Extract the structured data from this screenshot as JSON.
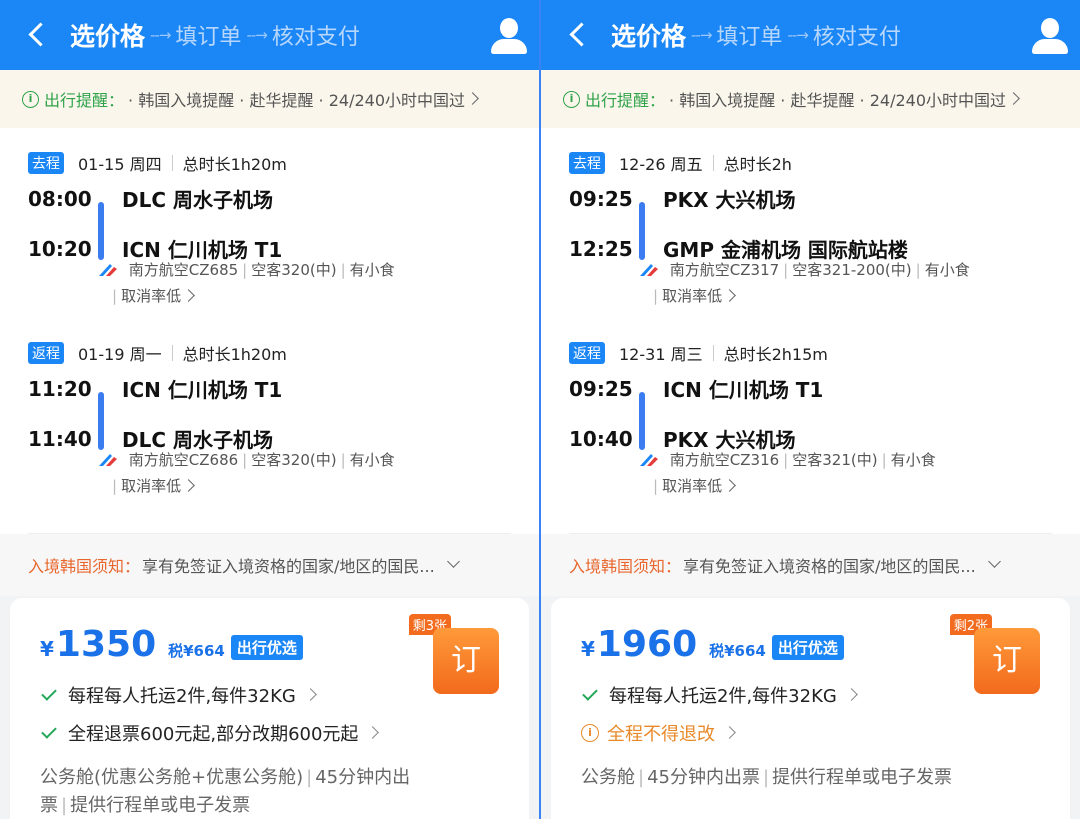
{
  "header": {
    "step_current": "选价格",
    "arrow": "--→",
    "step_2": "填订单",
    "step_3": "核对支付"
  },
  "reminder": {
    "title": "出行提醒",
    "colon": "：",
    "text": "· 韩国入境提醒 · 赴华提醒 · 24/240小时中国过"
  },
  "notice": {
    "title": "入境韩国须知",
    "colon": "：",
    "text": "享有免签证入境资格的国家/地区的国民..."
  },
  "left": {
    "outbound": {
      "tag": "去程",
      "date": "01-15 周四",
      "duration": "总时长1h20m",
      "dep_time": "08:00",
      "dep_airport": "DLC 周水子机场",
      "arr_time": "10:20",
      "arr_airport": "ICN 仁川机场 T1",
      "airline": "南方航空CZ685",
      "aircraft": "空客320(中)",
      "meal": "有小食",
      "cancel": "取消率低"
    },
    "return": {
      "tag": "返程",
      "date": "01-19 周一",
      "duration": "总时长1h20m",
      "dep_time": "11:20",
      "dep_airport": "ICN 仁川机场 T1",
      "arr_time": "11:40",
      "arr_airport": "DLC 周水子机场",
      "airline": "南方航空CZ686",
      "aircraft": "空客320(中)",
      "meal": "有小食",
      "cancel": "取消率低"
    },
    "card": {
      "currency": "¥",
      "price": "1350",
      "tax": "税¥664",
      "badge": "出行优选",
      "remain": "剩3张",
      "book": "订",
      "feature_1": "每程每人托运2件,每件32KG",
      "feature_2": "全程退票600元起,部分改期600元起",
      "cabin_1": "公务舱(优惠公务舱+优惠公务舱)",
      "cabin_2": "45分钟内出",
      "cabin_3": "票",
      "cabin_4": "提供行程单或电子发票"
    }
  },
  "right": {
    "outbound": {
      "tag": "去程",
      "date": "12-26 周五",
      "duration": "总时长2h",
      "dep_time": "09:25",
      "dep_airport": "PKX 大兴机场",
      "arr_time": "12:25",
      "arr_airport": "GMP 金浦机场 国际航站楼",
      "airline": "南方航空CZ317",
      "aircraft": "空客321-200(中)",
      "meal": "有小食",
      "cancel": "取消率低"
    },
    "return": {
      "tag": "返程",
      "date": "12-31 周三",
      "duration": "总时长2h15m",
      "dep_time": "09:25",
      "dep_airport": "ICN 仁川机场 T1",
      "arr_time": "10:40",
      "arr_airport": "PKX 大兴机场",
      "airline": "南方航空CZ316",
      "aircraft": "空客321(中)",
      "meal": "有小食",
      "cancel": "取消率低"
    },
    "card": {
      "currency": "¥",
      "price": "1960",
      "tax": "税¥664",
      "badge": "出行优选",
      "remain": "剩2张",
      "book": "订",
      "feature_1": "每程每人托运2件,每件32KG",
      "feature_2": "全程不得退改",
      "cabin_1": "公务舱",
      "cabin_2": "45分钟内出票",
      "cabin_3": "提供行程单或电子发票"
    }
  },
  "colors": {
    "header_blue": "#1b86f5",
    "price_blue": "#1b72e8",
    "green": "#2fa34a",
    "orange": "#f26a1c",
    "warn_orange": "#e88a2a"
  },
  "icons": {
    "back": "chevron-left-icon",
    "user": "user-icon",
    "info": "info-icon",
    "airline": "china-southern-logo-icon",
    "check": "check-icon"
  }
}
